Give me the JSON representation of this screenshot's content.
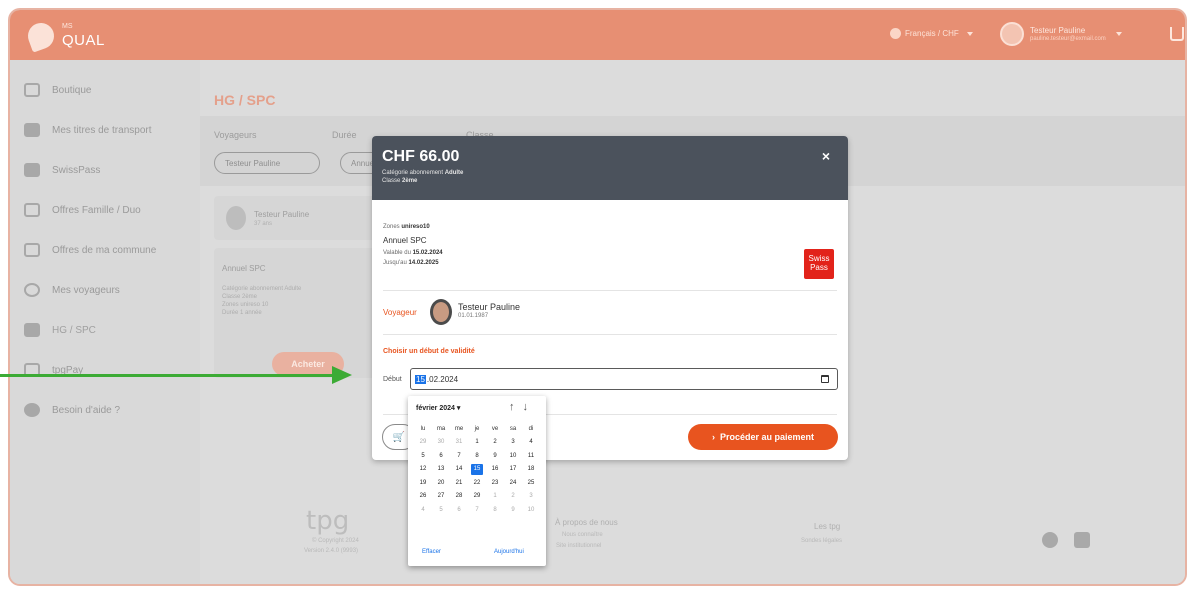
{
  "app": {
    "brand_small": "MS",
    "brand": "QUAL"
  },
  "header": {
    "language": "Français / CHF",
    "user_name": "Testeur Pauline",
    "user_email": "pauline.testeur@exmail.com"
  },
  "sidebar": {
    "items": [
      {
        "label": "Boutique",
        "icon": "home-icon"
      },
      {
        "label": "Mes titres de transport",
        "icon": "ticket-icon"
      },
      {
        "label": "SwissPass",
        "icon": "card-icon"
      },
      {
        "label": "Offres Famille / Duo",
        "icon": "family-icon"
      },
      {
        "label": "Offres de ma commune",
        "icon": "shield-icon"
      },
      {
        "label": "Mes voyageurs",
        "icon": "users-icon"
      },
      {
        "label": "HG / SPC",
        "icon": "group-icon"
      },
      {
        "label": "tpgPay",
        "icon": "pay-icon"
      },
      {
        "label": "Besoin d'aide ?",
        "icon": "help-icon"
      }
    ]
  },
  "main": {
    "title": "HG / SPC",
    "filters": {
      "voyageurs": "Voyageurs",
      "duree": "Durée",
      "classe": "Classe",
      "traveler_pill": "Testeur Pauline",
      "duration_pill": "Annuel"
    },
    "profile": {
      "name": "Testeur Pauline",
      "age": "37 ans"
    },
    "abo": {
      "title": "Annuel SPC",
      "lines": [
        "Catégorie abonnement Adulte",
        "Classe 2ème",
        "Zones unireso 10",
        "Durée 1 année"
      ],
      "buy": "Acheter"
    }
  },
  "footer": {
    "brand": "tpg",
    "copyright": "© Copyright 2024",
    "version": "Version 2.4.0 (9993)",
    "about": "À propos de nous",
    "about_1": "Nous connaître",
    "about_2": "Site institutionnel",
    "tpg": "Les tpg",
    "tpg_1": "Sondes légales"
  },
  "modal": {
    "price": "CHF 66.00",
    "category": "Catégorie abonnement",
    "category_value": "Adulte",
    "class": "Classe",
    "class_value": "2ème",
    "close": "×",
    "zones": "Zones",
    "zones_value": "unireso10",
    "product": "Annuel SPC",
    "valid_from": "Valable du",
    "valid_from_value": "15.02.2024",
    "valid_until": "Jusqu'au",
    "valid_until_value": "14.02.2025",
    "swisspass": "Swiss Pass",
    "voyageur_label": "Voyageur",
    "voyageur_name": "Testeur Pauline",
    "voyageur_dob": "01.01.1987",
    "choose_validity": "Choisir un début de validité",
    "debut_label": "Début",
    "date_day": "15",
    "date_rest": ".02.2024",
    "pay": "Procéder au paiement"
  },
  "datepicker": {
    "month": "février 2024",
    "weekdays": [
      "lu",
      "ma",
      "me",
      "je",
      "ve",
      "sa",
      "di"
    ],
    "weeks": [
      [
        "29",
        "30",
        "31",
        "1",
        "2",
        "3",
        "4"
      ],
      [
        "5",
        "6",
        "7",
        "8",
        "9",
        "10",
        "11"
      ],
      [
        "12",
        "13",
        "14",
        "15",
        "16",
        "17",
        "18"
      ],
      [
        "19",
        "20",
        "21",
        "22",
        "23",
        "24",
        "25"
      ],
      [
        "26",
        "27",
        "28",
        "29",
        "1",
        "2",
        "3"
      ],
      [
        "4",
        "5",
        "6",
        "7",
        "8",
        "9",
        "10"
      ]
    ],
    "selected": "15",
    "clear": "Effacer",
    "today": "Aujourd'hui"
  },
  "colors": {
    "accent": "#e8541f",
    "header_dim": "#e78f73",
    "modal_header": "#4b525c",
    "selection": "#1a73e8",
    "annotation_arrow": "#3cab35"
  }
}
